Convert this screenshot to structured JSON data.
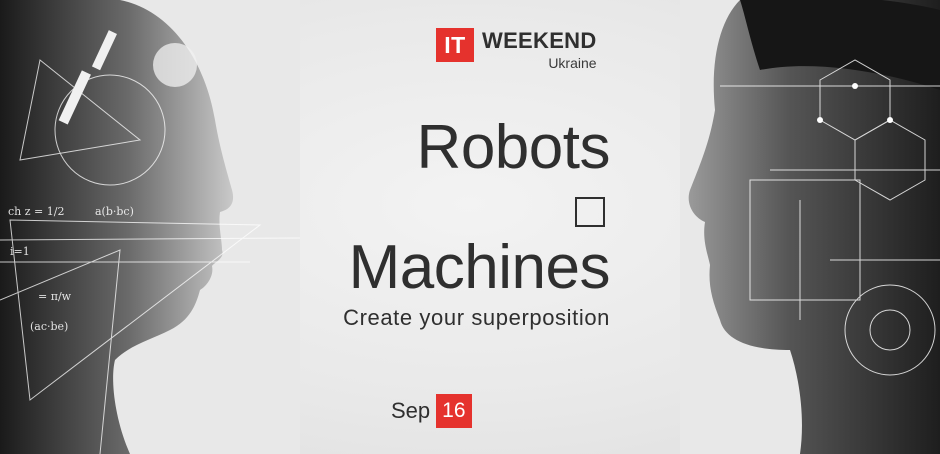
{
  "logo": {
    "badge": "IT",
    "name": "WEEKEND",
    "country": "Ukraine"
  },
  "headline": {
    "line1": "Robots",
    "line2": "Machines"
  },
  "tagline": "Create your superposition",
  "date": {
    "month": "Sep",
    "day": "16"
  },
  "colors": {
    "accent": "#e5322d",
    "text": "#2f2f2f",
    "background": "#ebebeb"
  },
  "artwork": {
    "left": "woman-profile-with-math-formula-overlay",
    "right": "man-profile-with-engineering-blueprint-overlay"
  },
  "icons": [
    "operator-square-icon"
  ]
}
